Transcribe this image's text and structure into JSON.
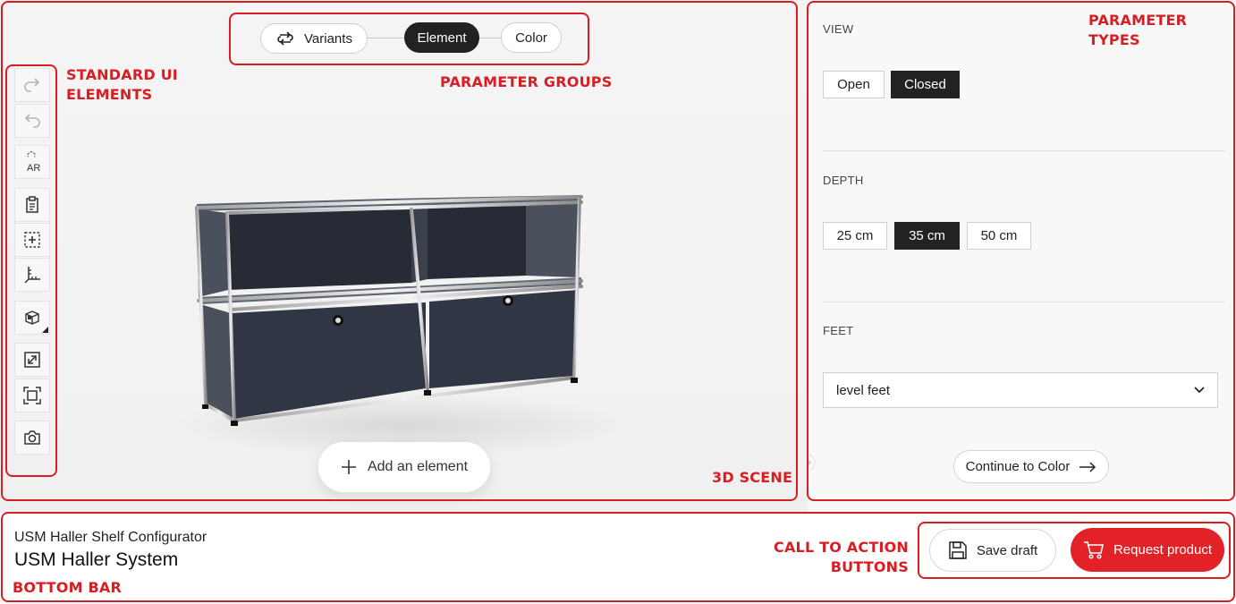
{
  "groups": {
    "variants": "Variants",
    "element": "Element",
    "color": "Color"
  },
  "scene": {
    "add_element": "Add an element"
  },
  "toolbar": {
    "ar_label": "AR"
  },
  "panel": {
    "view": {
      "title": "VIEW",
      "options": [
        "Open",
        "Closed"
      ],
      "selected": "Closed"
    },
    "depth": {
      "title": "DEPTH",
      "options": [
        "25 cm",
        "35 cm",
        "50 cm"
      ],
      "selected": "35 cm"
    },
    "feet": {
      "title": "FEET",
      "selected": "level feet"
    },
    "continue": "Continue to Color"
  },
  "bottom": {
    "subtitle": "USM Haller Shelf Configurator",
    "title": "USM Haller System",
    "save_draft": "Save draft",
    "request_product": "Request product"
  },
  "annotations": {
    "standard_ui": "STANDARD UI ELEMENTS",
    "parameter_groups": "PARAMETER GROUPS",
    "parameter_types": "PARAMETER TYPES",
    "scene_3d": "3D SCENE",
    "bottom_bar": "BOTTOM BAR",
    "cta_buttons": "CALL TO ACTION BUTTONS"
  },
  "colors": {
    "accent": "#e32228",
    "annotation": "#d81e22",
    "active": "#222222"
  }
}
